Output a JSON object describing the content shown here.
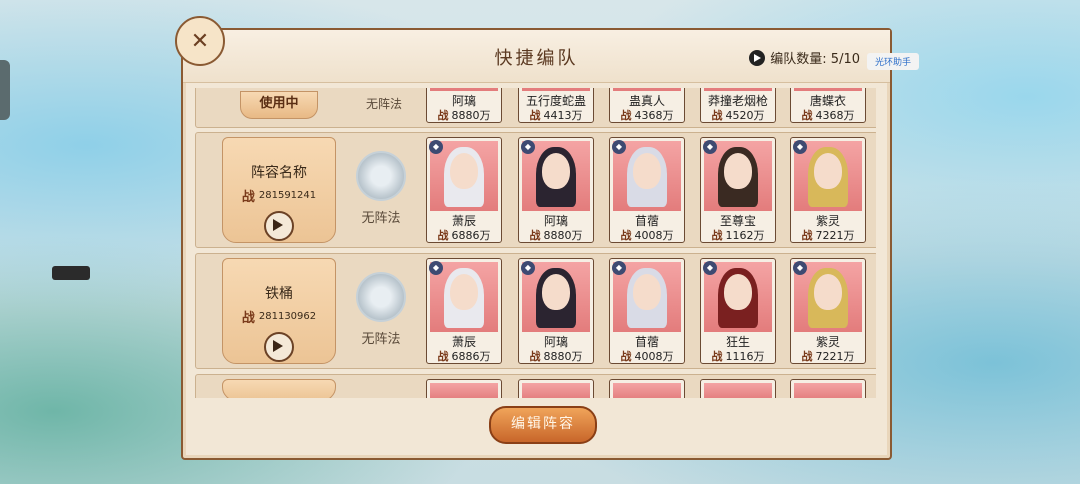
{
  "helper_badge": "光环助手",
  "panel": {
    "title": "快捷编队",
    "count_label": "编队数量: 5/10",
    "edit_button": "编辑阵容"
  },
  "power_char": "战",
  "top_row": {
    "status": "使用中",
    "formation": "无阵法",
    "heroes": [
      {
        "name": "阿璃",
        "power": "8880万"
      },
      {
        "name": "五行度蛇蛊",
        "power": "4413万"
      },
      {
        "name": "蛊真人",
        "power": "4368万"
      },
      {
        "name": "莽撞老烟枪",
        "power": "4520万"
      },
      {
        "name": "唐蝶衣",
        "power": "4368万"
      }
    ]
  },
  "teams": [
    {
      "name": "阵容名称",
      "power": "281591241",
      "formation": "无阵法",
      "heroes": [
        {
          "name": "萧辰",
          "power": "6886万",
          "color": "#e9e9ee"
        },
        {
          "name": "阿璃",
          "power": "8880万",
          "color": "#2b2430"
        },
        {
          "name": "苜蓿",
          "power": "4008万",
          "color": "#d9dbe6"
        },
        {
          "name": "至尊宝",
          "power": "1162万",
          "color": "#3a2a22"
        },
        {
          "name": "紫灵",
          "power": "7221万",
          "color": "#d8b85a"
        }
      ]
    },
    {
      "name": "铁桶",
      "power": "281130962",
      "formation": "无阵法",
      "heroes": [
        {
          "name": "萧辰",
          "power": "6886万",
          "color": "#e9e9ee"
        },
        {
          "name": "阿璃",
          "power": "8880万",
          "color": "#2b2430"
        },
        {
          "name": "苜蓿",
          "power": "4008万",
          "color": "#d9dbe6"
        },
        {
          "name": "狂生",
          "power": "1116万",
          "color": "#7a2020"
        },
        {
          "name": "紫灵",
          "power": "7221万",
          "color": "#d8b85a"
        }
      ]
    }
  ]
}
